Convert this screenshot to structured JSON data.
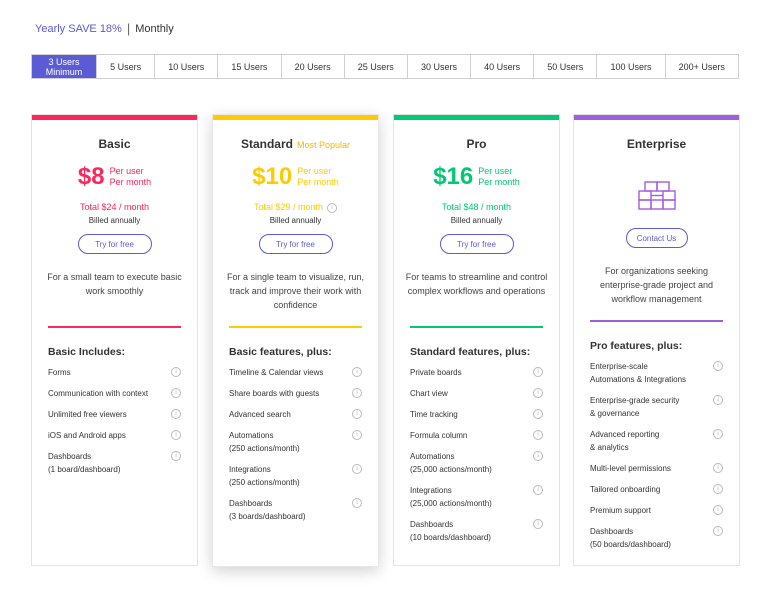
{
  "billing": {
    "yearly_label": "Yearly SAVE 18%",
    "separator": "|",
    "monthly_label": "Monthly"
  },
  "users": {
    "options": [
      "3 Users",
      "5 Users",
      "10 Users",
      "15 Users",
      "20 Users",
      "25 Users",
      "30 Users",
      "40 Users",
      "50 Users",
      "100 Users",
      "200+ Users"
    ],
    "minimum_note": "Minimum",
    "selected_index": 0
  },
  "colors": {
    "accent": "#5b5bd6",
    "basic": "#fb275d",
    "standard": "#ffcb00",
    "pro": "#00c875",
    "enterprise": "#a25ddc"
  },
  "plans": [
    {
      "name": "Basic",
      "price": "$8",
      "per_line1": "Per user",
      "per_line2": "Per month",
      "total": "Total $24 / month",
      "billed": "Billed annually",
      "cta": "Try for free",
      "description": "For a small team to execute basic work smoothly",
      "features_heading": "Basic Includes:",
      "features": [
        "Forms",
        "Communication with context",
        "Unlimited free viewers",
        "iOS and Android apps",
        "Dashboards\n(1 board/dashboard)"
      ]
    },
    {
      "name": "Standard",
      "badge": "Most Popular",
      "price": "$10",
      "per_line1": "Per user",
      "per_line2": "Per month",
      "total": "Total $29 / month",
      "billed": "Billed annually",
      "cta": "Try for free",
      "description": "For a single team to visualize, run, track and improve their work with confidence",
      "features_heading": "Basic features, plus:",
      "features": [
        "Timeline & Calendar views",
        "Share boards with guests",
        "Advanced search",
        "Automations\n(250 actions/month)",
        "Integrations\n(250 actions/month)",
        "Dashboards\n(3 boards/dashboard)"
      ]
    },
    {
      "name": "Pro",
      "price": "$16",
      "per_line1": "Per user",
      "per_line2": "Per month",
      "total": "Total $48 / month",
      "billed": "Billed annually",
      "cta": "Try for free",
      "description": "For teams to streamline and control complex workflows and operations",
      "features_heading": "Standard features, plus:",
      "features": [
        "Private boards",
        "Chart view",
        "Time tracking",
        "Formula column",
        "Automations\n(25,000 actions/month)",
        "Integrations\n(25,000 actions/month)",
        "Dashboards\n(10 boards/dashboard)"
      ]
    },
    {
      "name": "Enterprise",
      "icon": "building-blocks-icon",
      "cta": "Contact Us",
      "description": "For organizations seeking enterprise-grade project and workflow management",
      "features_heading": "Pro features, plus:",
      "features": [
        "Enterprise-scale\nAutomations & Integrations",
        "Enterprise-grade security\n& governance",
        "Advanced reporting\n& analytics",
        "Multi-level permissions",
        "Tailored onboarding",
        "Premium support",
        "Dashboards\n(50 boards/dashboard)"
      ]
    }
  ]
}
